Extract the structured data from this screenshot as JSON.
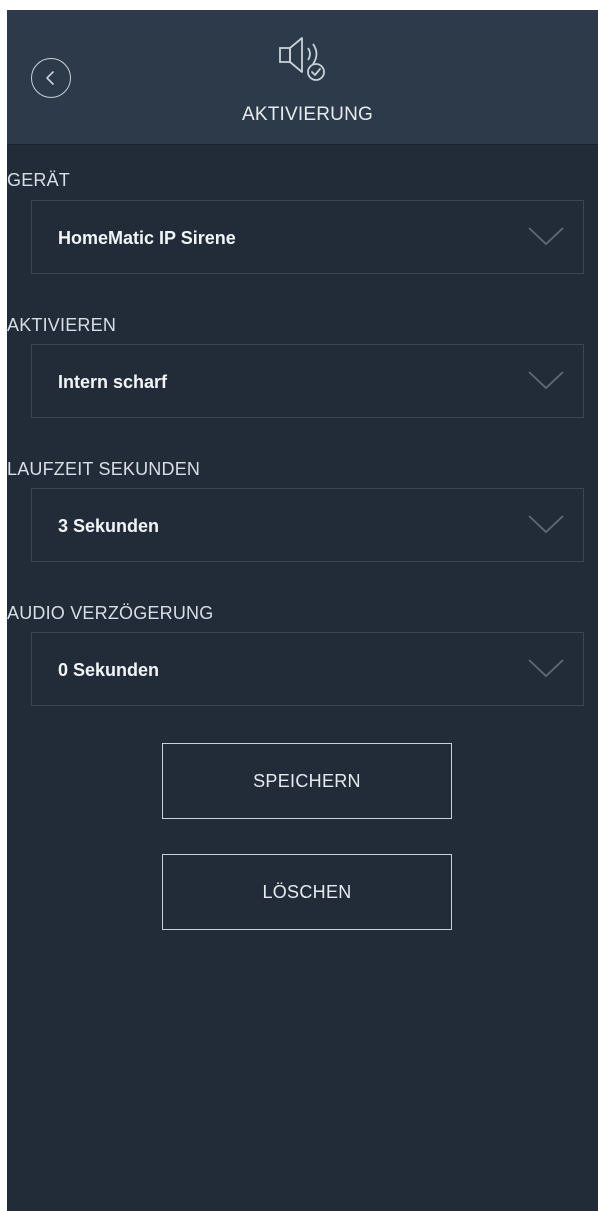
{
  "header": {
    "title": "AKTIVIERUNG",
    "icon": "speaker-check-icon",
    "back_icon": "back-chevron-icon"
  },
  "form": {
    "fields": [
      {
        "label": "GERÄT",
        "value": "HomeMatic IP Sirene"
      },
      {
        "label": "AKTIVIEREN",
        "value": "Intern scharf"
      },
      {
        "label": "LAUFZEIT SEKUNDEN",
        "value": "3 Sekunden"
      },
      {
        "label": "AUDIO VERZÖGERUNG",
        "value": "0 Sekunden"
      }
    ]
  },
  "actions": {
    "save_label": "SPEICHERN",
    "delete_label": "LÖSCHEN"
  },
  "colors": {
    "background": "#222c38",
    "header": "#2d3a49",
    "text": "#e6ebf0"
  }
}
